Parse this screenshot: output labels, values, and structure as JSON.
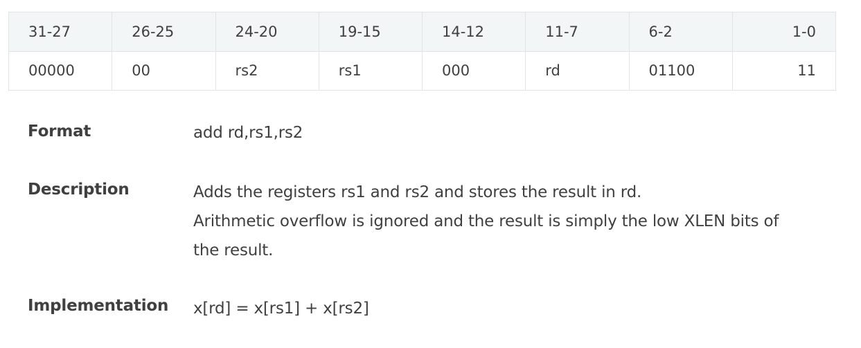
{
  "encoding": {
    "bit_ranges": [
      "31-27",
      "26-25",
      "24-20",
      "19-15",
      "14-12",
      "11-7",
      "6-2",
      "1-0"
    ],
    "values": [
      "00000",
      "00",
      "rs2",
      "rs1",
      "000",
      "rd",
      "01100",
      "11"
    ]
  },
  "format": {
    "label": "Format",
    "value": "add rd,rs1,rs2"
  },
  "description": {
    "label": "Description",
    "lines": [
      "Adds the registers rs1 and rs2 and stores the result in rd.",
      "Arithmetic overflow is ignored and the result is simply the low XLEN bits of",
      "the result."
    ]
  },
  "implementation": {
    "label": "Implementation",
    "value": "x[rd] = x[rs1] + x[rs2]"
  }
}
